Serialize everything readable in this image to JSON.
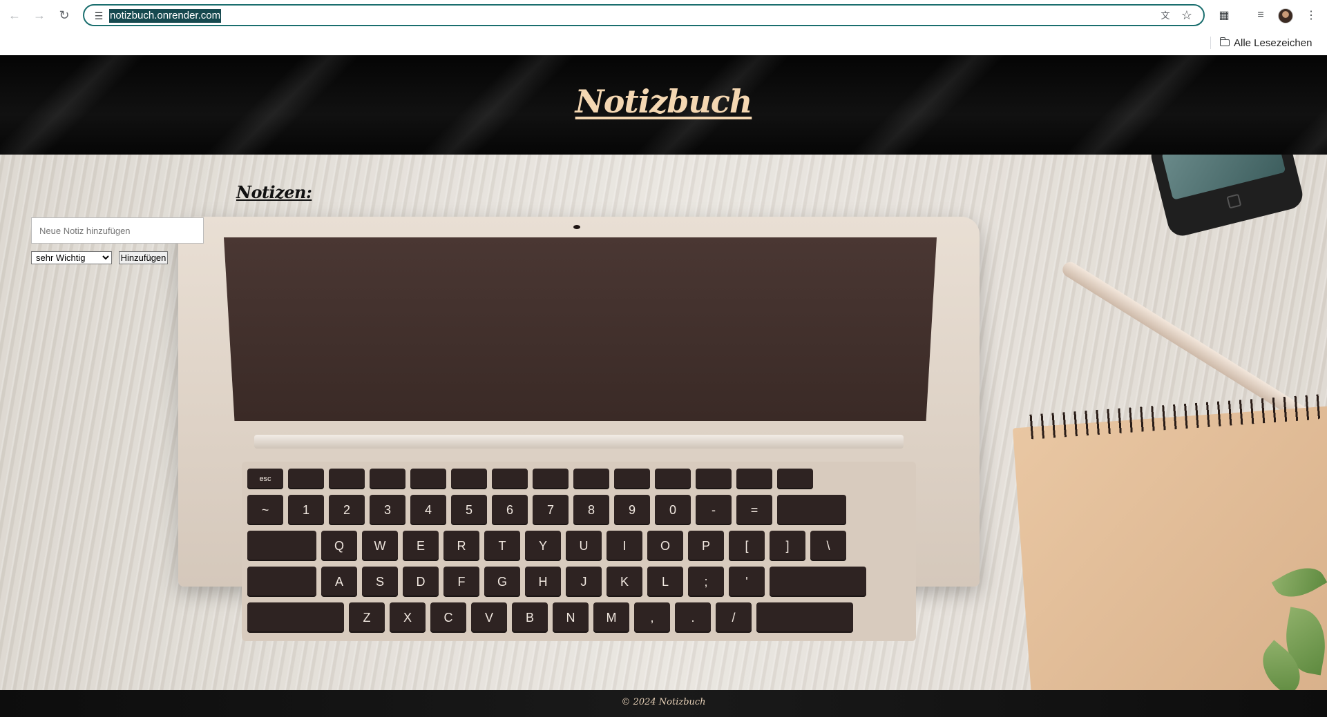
{
  "browser": {
    "url": "notizbuch.onrender.com",
    "bookmarks_label": "Alle Lesezeichen",
    "icons": {
      "back": "arrow-left-icon",
      "forward": "arrow-right-icon",
      "reload": "reload-icon",
      "site_info": "tune-icon",
      "translate": "translate-icon",
      "bookmark": "star-icon",
      "extensions": "puzzle-icon",
      "media": "media-queue-icon",
      "menu": "kebab-menu-icon",
      "folder": "folder-icon"
    }
  },
  "site": {
    "title": "Notizbuch",
    "notes_heading": "Notizen:",
    "input_placeholder": "Neue Notiz hinzufügen",
    "input_value": "",
    "priority_selected": "sehr Wichtig",
    "add_button_label": "Hinzufügen",
    "footer": "© 2024 Notizbuch"
  },
  "colors": {
    "title_color": "#f4d7b2",
    "header_bg": "#0a0a0a",
    "omnibox_border": "#1a6e6e",
    "url_highlight": "#16494f"
  }
}
